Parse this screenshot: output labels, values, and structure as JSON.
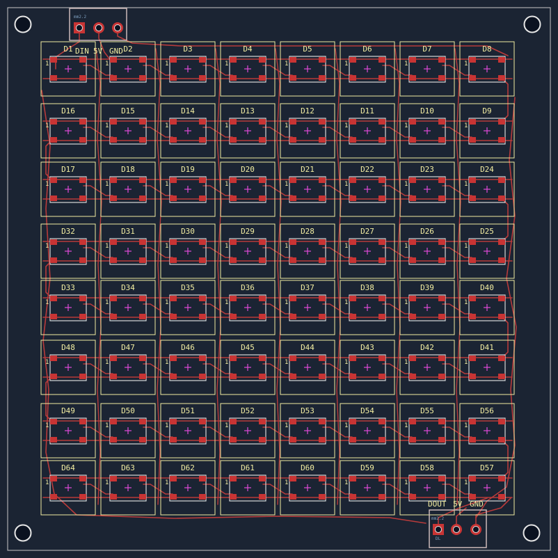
{
  "colors": {
    "background": "#1b2433",
    "board_edge": "#c8c8c8",
    "silkscreen": "#f2eda1",
    "courtyard": "#d8d8d8",
    "copper_pad": "#c83434",
    "trace": "#b83b3b",
    "anchor": "#e04ad8",
    "hole": "#0b1220",
    "via_fill": "#c7a9a9",
    "connector_outline": "#cdb9b9",
    "dim_text": "#7fa0c0"
  },
  "leds": {
    "rows": [
      [
        "D1",
        "D2",
        "D3",
        "D4",
        "D5",
        "D6",
        "D7",
        "D8"
      ],
      [
        "D16",
        "D15",
        "D14",
        "D13",
        "D12",
        "D11",
        "D10",
        "D9"
      ],
      [
        "D17",
        "D18",
        "D19",
        "D20",
        "D21",
        "D22",
        "D23",
        "D24"
      ],
      [
        "D32",
        "D31",
        "D30",
        "D29",
        "D28",
        "D27",
        "D26",
        "D25"
      ],
      [
        "D33",
        "D34",
        "D35",
        "D36",
        "D37",
        "D38",
        "D39",
        "D40"
      ],
      [
        "D48",
        "D47",
        "D46",
        "D45",
        "D44",
        "D43",
        "D42",
        "D41"
      ],
      [
        "D49",
        "D50",
        "D51",
        "D52",
        "D53",
        "D54",
        "D55",
        "D56"
      ],
      [
        "D64",
        "D63",
        "D62",
        "D61",
        "D60",
        "D59",
        "D58",
        "D57"
      ]
    ],
    "pin1_marker": "1"
  },
  "connectors": {
    "input": {
      "labels": [
        "DIN",
        "5V",
        "GND"
      ],
      "pitch_text": "mm2.2"
    },
    "output": {
      "labels": [
        "DOUT",
        "5V",
        "GND"
      ],
      "pitch_text": "mm2.2",
      "bottom_text": "DL"
    }
  }
}
